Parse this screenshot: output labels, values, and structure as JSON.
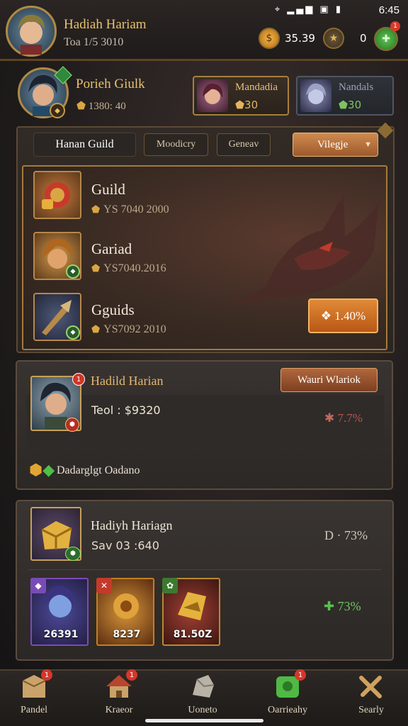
{
  "status_bar": {
    "time": "6:45",
    "icons": "⌖ ▂▄▆ ▣ ▮"
  },
  "player": {
    "name": "Hadiah Hariam",
    "subtitle": "Toa 1/5 3010"
  },
  "currency": {
    "coins": "35.39",
    "stars": "0",
    "gem_badge": "1"
  },
  "guild": {
    "name": "Porieh Giulk",
    "stat": "1380: 40",
    "members": [
      {
        "name": "Mandadia",
        "value": "30",
        "accent": "#e3b45d"
      },
      {
        "name": "Nandals",
        "value": "30",
        "accent": "#7fc45f"
      }
    ]
  },
  "tabs": {
    "main": "Hanan Guild",
    "modern": "Moodicry",
    "general": "Geneav",
    "dropdown": "Vilegje"
  },
  "guild_list": [
    {
      "name": "Guild",
      "stat": "YS 7040 2000",
      "icon": "guild-emblem-icon"
    },
    {
      "name": "Gariad",
      "stat": "YS7040.2016",
      "icon": "hero-portrait-icon"
    },
    {
      "name": "Gguids",
      "stat": "YS7092 2010",
      "icon": "weapon-icon"
    }
  ],
  "reward_button": "❖ 1.40%",
  "member_panel": {
    "name": "Hadild Harian",
    "visit_button": "Wauri Wlariok",
    "value": "Teol : $9320",
    "percent": "7.7%",
    "perk_label": "Dadarglgt Oadano",
    "badge": "1"
  },
  "rewards_panel": {
    "name": "Hadiyh Hariagn",
    "subtitle": "Sav 03 :640",
    "percent": "D · 73%",
    "bonus_percent": "73%",
    "cards": [
      {
        "value": "26391",
        "color": "#7a4bb8"
      },
      {
        "value": "8237",
        "color": "#c47f22"
      },
      {
        "value": "81.50Z",
        "color": "#b9892f"
      }
    ]
  },
  "nav": [
    {
      "label": "Pandel",
      "badge": "1",
      "icon": "shop-icon"
    },
    {
      "label": "Kraeor",
      "badge": "1",
      "icon": "house-icon"
    },
    {
      "label": "Uoneto",
      "badge": "",
      "icon": "rock-icon"
    },
    {
      "label": "Oarrieahy",
      "badge": "1",
      "icon": "guild-icon"
    },
    {
      "label": "Searly",
      "badge": "",
      "icon": "tools-icon"
    }
  ]
}
